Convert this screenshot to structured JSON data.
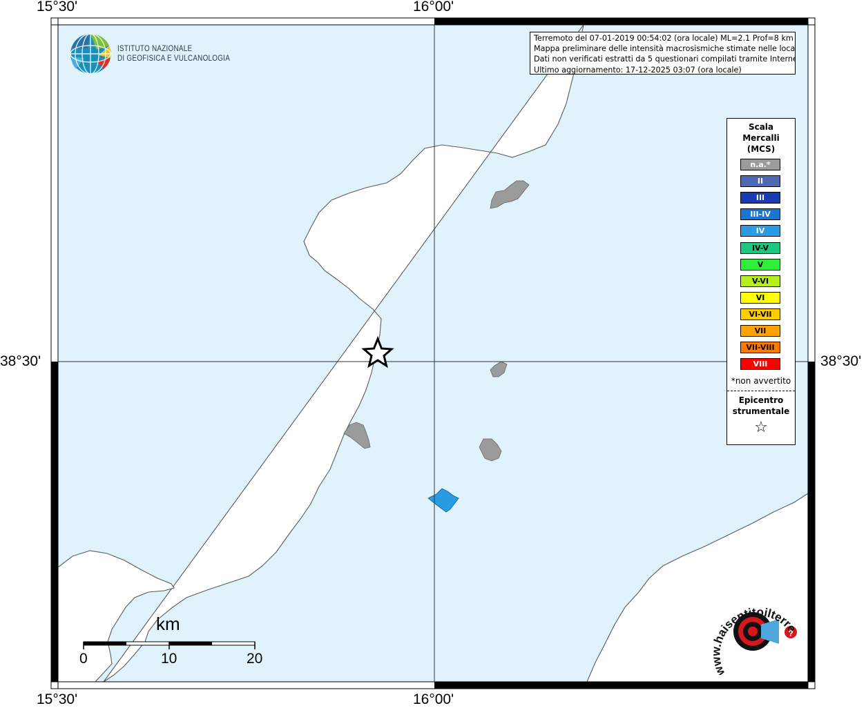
{
  "coords": {
    "top_left": "15°30'",
    "top_mid": "16°00'",
    "bottom_left": "15°30'",
    "bottom_mid": "16°00'",
    "left_mid": "38°30'",
    "right_mid": "38°30'"
  },
  "logo": {
    "line1": "ISTITUTO NAZIONALE",
    "line2": "DI GEOFISICA E VULCANOLOGIA"
  },
  "info": {
    "line1": "Terremoto del 07-01-2019 00:54:02 (ora locale) ML=2.1 Prof=8 km",
    "line2": "Mappa preliminare delle intensità macrosismiche stimate nelle località",
    "line3": "Dati non verificati estratti da 5 questionari compilati tramite Internet.",
    "line4": "Ultimo aggiornamento: 17-12-2025 03:07 (ora locale)"
  },
  "legend": {
    "title1": "Scala",
    "title2": "Mercalli",
    "title3": "(MCS)",
    "items": [
      {
        "label": "n.a.*",
        "color": "#9b9b9b",
        "text_color": "#ffffff"
      },
      {
        "label": "II",
        "color": "#4f68b3",
        "text_color": "#ffffff"
      },
      {
        "label": "III",
        "color": "#1a3bb6",
        "text_color": "#ffffff"
      },
      {
        "label": "III-IV",
        "color": "#1b76cf",
        "text_color": "#ffffff"
      },
      {
        "label": "IV",
        "color": "#2a9ce3",
        "text_color": "#ffffff"
      },
      {
        "label": "IV-V",
        "color": "#1ec77f",
        "text_color": "#000000"
      },
      {
        "label": "V",
        "color": "#2ef03a",
        "text_color": "#000000"
      },
      {
        "label": "V-VI",
        "color": "#b7ee1e",
        "text_color": "#000000"
      },
      {
        "label": "VI",
        "color": "#ffff00",
        "text_color": "#000000"
      },
      {
        "label": "VI-VII",
        "color": "#ffcc00",
        "text_color": "#000000"
      },
      {
        "label": "VII",
        "color": "#ffa200",
        "text_color": "#000000"
      },
      {
        "label": "VII-VIII",
        "color": "#ff7a00",
        "text_color": "#000000"
      },
      {
        "label": "VIII",
        "color": "#ff0000",
        "text_color": "#ffffff"
      }
    ],
    "note": "*non avvertito",
    "epi1": "Epicentro",
    "epi2": "strumentale",
    "epi_symbol": "☆"
  },
  "scalebar": {
    "unit": "km",
    "ticks": [
      "0",
      "10",
      "20"
    ]
  },
  "hst_logo": {
    "text": "www.haisentitoilterremoto.it",
    "question": "?"
  },
  "colors": {
    "sea": "#e0f2fc",
    "land": "#ffffff",
    "coast": "#5a5a5a",
    "locality_na": "#9b9b9b",
    "locality_iv": "#2a9ce3"
  }
}
